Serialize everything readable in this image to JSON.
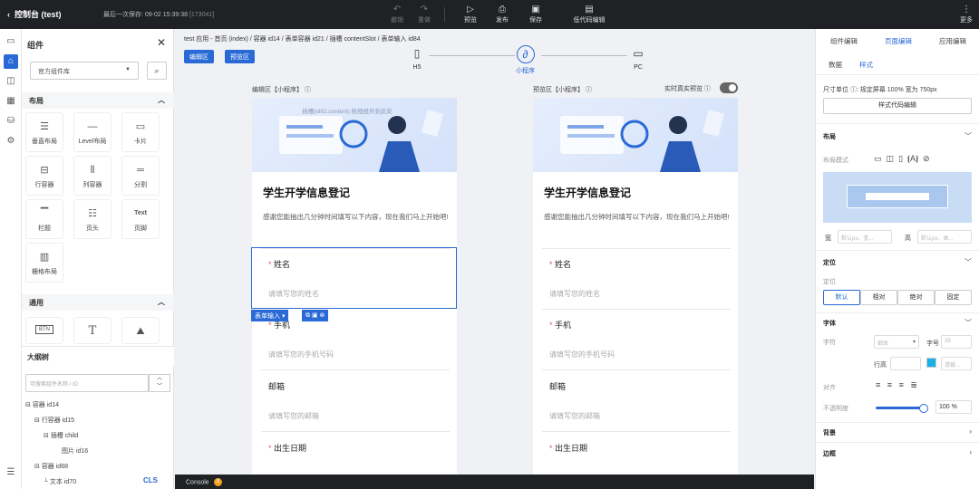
{
  "topbar": {
    "back_label": "控制台 (test)",
    "saved_text": "最后一次保存: 09-02 15:39:38",
    "saved_id": "[173041]",
    "undo_label": "撤销",
    "redo_label": "重做",
    "preview_label": "预览",
    "publish_label": "发布",
    "save_label": "保存",
    "lowcode_label": "低代码编辑",
    "more_label": "更多"
  },
  "left_panel": {
    "title": "组件",
    "library_select": "官方组件库",
    "layout_section": "布局",
    "layout_items": [
      "垂直布局",
      "Level布局",
      "卡片",
      "行容器",
      "列容器",
      "分割",
      "栏题",
      "页头",
      "页脚",
      "栅格布局"
    ],
    "footer_tile_text": "Text",
    "general_section": "通用",
    "general_items_glyphs": [
      "BTN",
      "T",
      "image"
    ],
    "tree_title": "大纲树",
    "tree_search_placeholder": "可搜索组件名称 / ID",
    "tree_nodes": [
      "容器 id14",
      "行容器 id15",
      "插槽 child",
      "图片 id16",
      "容器 id68",
      "文本 id70"
    ],
    "cls_badge": "CLS"
  },
  "canvas": {
    "breadcrumb": "test 应用 - 首页 (index)  /  容器 id14  /  表单容器 id21  /  插槽 contentSlot  /  表单输入 id84",
    "edit_button": "编辑区",
    "preview_button": "预览区",
    "devices": [
      "H5",
      "小程序",
      "PC"
    ],
    "edit_pane_label": "编辑区【小程序】",
    "preview_pane_label": "预览区【小程序】",
    "realtime_label": "实时真实预览",
    "banner_hint": "插槽(id92.content) 拖拽组件到此处",
    "form_title": "学生开学信息登记",
    "form_desc": "感谢您能抽出几分钟时间填写以下内容，现在我们马上开始吧!",
    "fields": [
      {
        "label": "姓名",
        "required": true,
        "placeholder": "请填写您的姓名"
      },
      {
        "label": "手机",
        "required": true,
        "placeholder": "请填写您的手机号码"
      },
      {
        "label": "邮箱",
        "required": false,
        "placeholder": "请填写您的邮箱"
      },
      {
        "label": "出生日期",
        "required": true,
        "placeholder": ""
      }
    ],
    "selection_tag": "表单输入"
  },
  "console": {
    "label": "Console",
    "count": "3"
  },
  "right_panel": {
    "tabs": [
      "组件编辑",
      "页面编辑",
      "应用编辑"
    ],
    "subtabs": [
      "数据",
      "样式"
    ],
    "unit_label": "尺寸单位",
    "unit_value": "规定屏幕 100% 宽为 750px",
    "style_code_button": "样式代码编辑",
    "layout_section": "布局",
    "layout_mode_label": "布局模式",
    "width_label": "宽",
    "height_label": "高",
    "width_placeholder": "默认px、宽...",
    "height_placeholder": "默认px、高...",
    "position_section": "定位",
    "position_label": "定位",
    "position_options": [
      "默认",
      "相对",
      "绝对",
      "固定"
    ],
    "font_section": "字体",
    "font_label": "字符",
    "font_select": "细体",
    "font_size_label": "字号",
    "font_size_placeholder": "38",
    "line_height_label": "行高",
    "color_placeholder": "请输...",
    "align_label": "对齐",
    "opacity_label": "不透明度",
    "opacity_value": "100 %",
    "background_section": "背景",
    "border_section": "边框"
  }
}
